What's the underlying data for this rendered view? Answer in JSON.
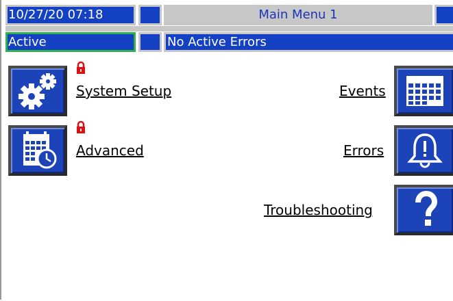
{
  "header": {
    "datetime": "10/27/20 07:18",
    "title": "Main Menu 1",
    "status": "Active",
    "errors": "No Active Errors"
  },
  "menu": {
    "system_setup": "System Setup",
    "advanced": "Advanced",
    "events": "Events",
    "errors": "Errors",
    "troubleshooting": "Troubleshooting"
  },
  "icons": {
    "system_setup": "gears-icon",
    "advanced": "calendar-clock-icon",
    "events": "calendar-grid-icon",
    "errors": "bell-alert-icon",
    "troubleshooting": "question-icon",
    "locked": "padlock-icon"
  },
  "colors": {
    "accent": "#1440c4",
    "status_border": "#2fb24a",
    "lock": "#e01010"
  }
}
